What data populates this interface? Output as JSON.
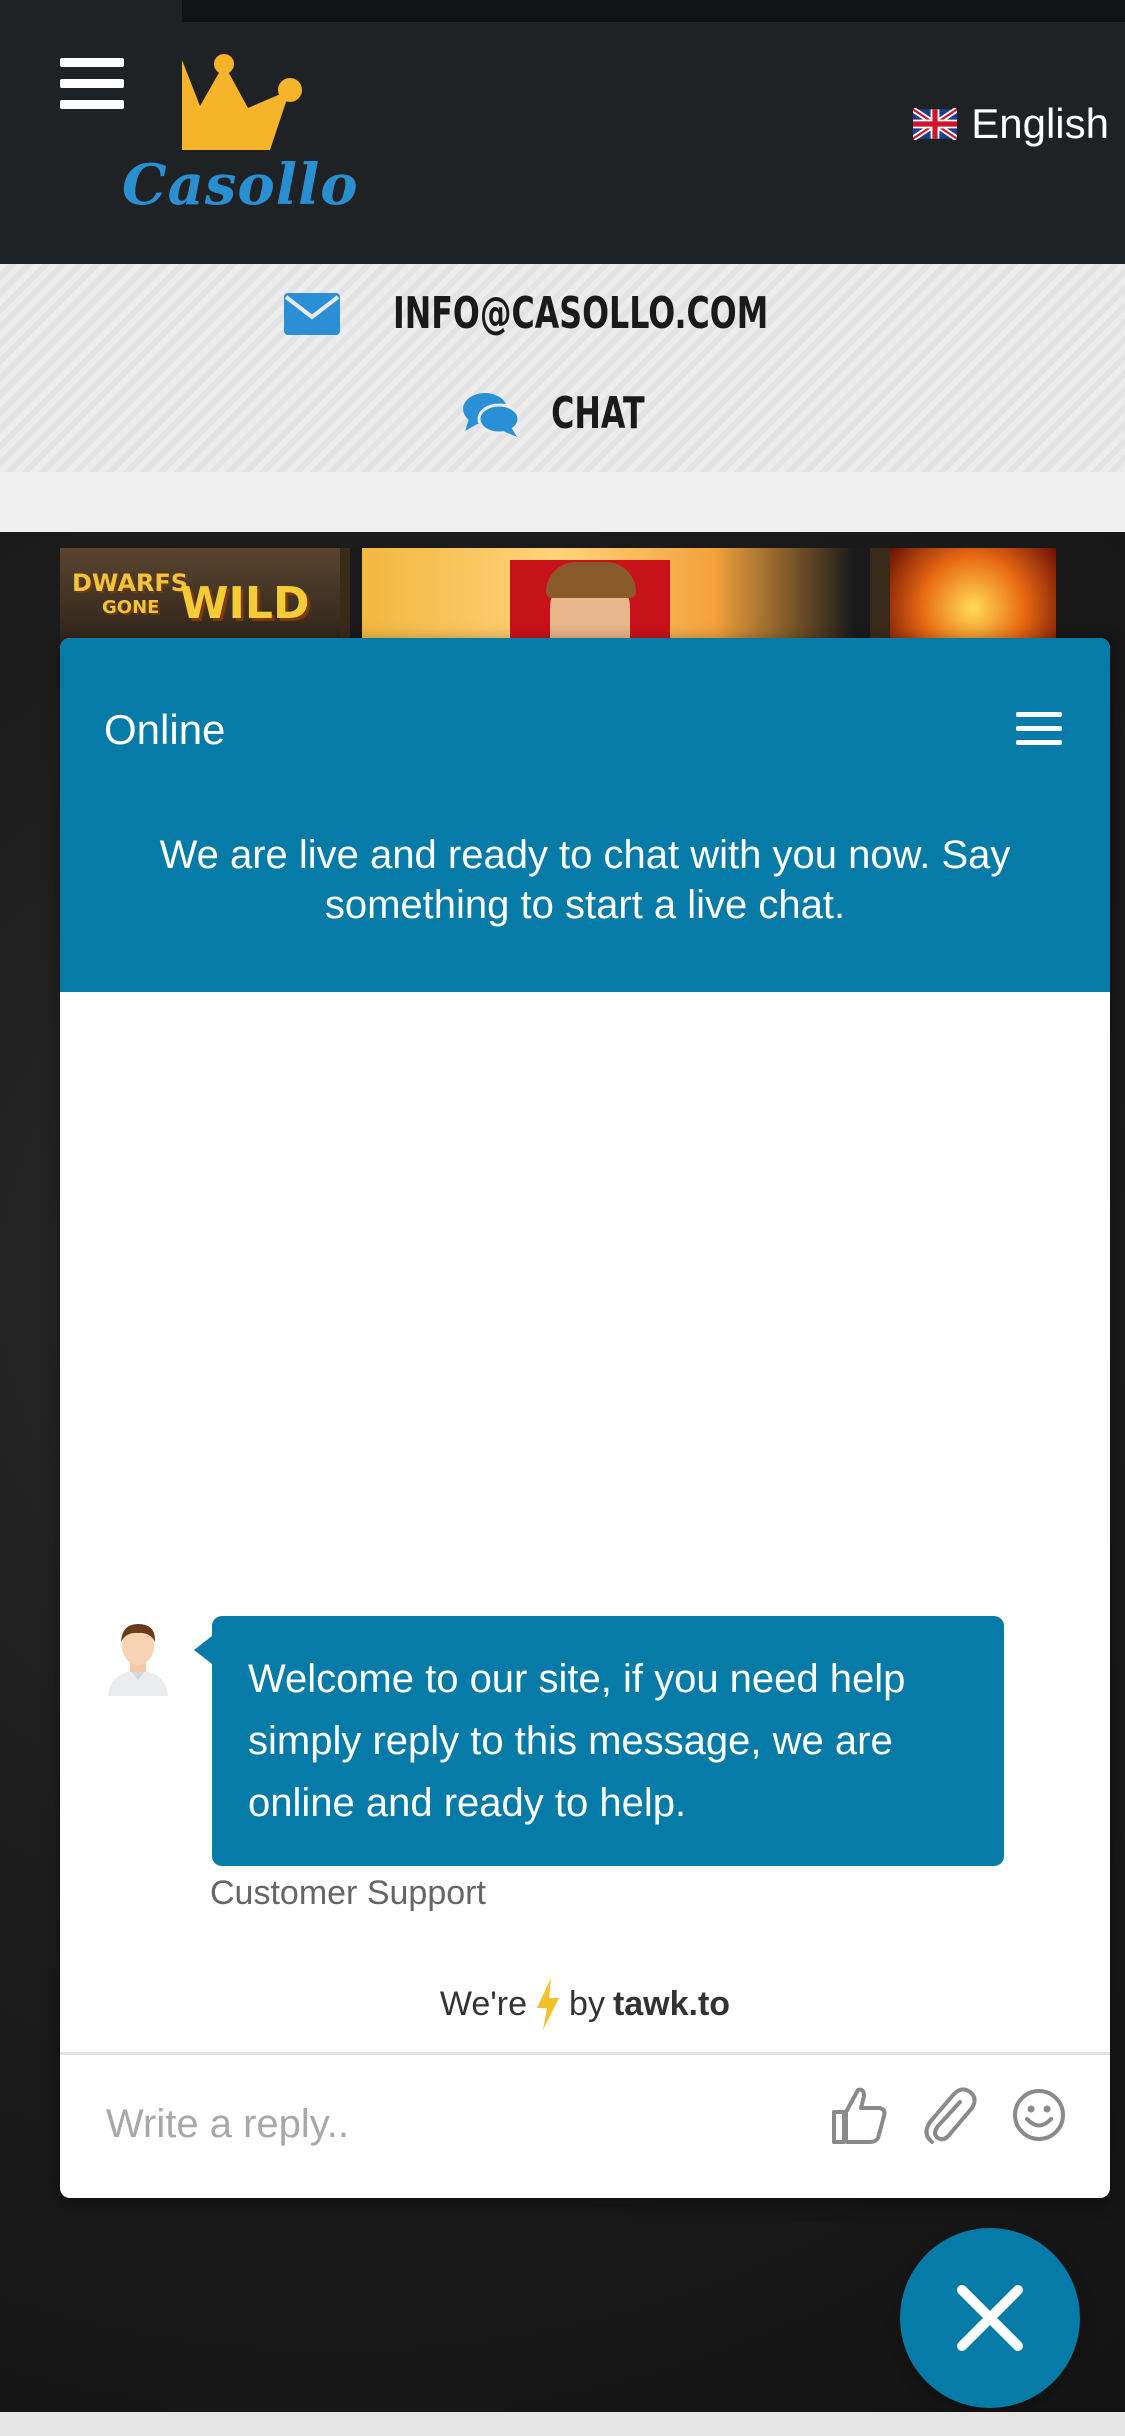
{
  "header": {
    "logo_text": "Casollo",
    "language": "English"
  },
  "contact": {
    "email": "INFO@CASOLLO.COM",
    "chat": "CHAT"
  },
  "banner": {
    "game_1_top": "DWARFS",
    "game_1_sub": "GONE",
    "game_1_word": "WILD"
  },
  "chat_widget": {
    "status": "Online",
    "intro": "We are live and ready to chat with you now. Say something to start a live chat.",
    "message": "Welcome to our site, if you need help simply reply to this message, we are online and ready to help.",
    "sender": "Customer Support",
    "powered_pre": "We're",
    "powered_mid": "by",
    "powered_brand": "tawk.to",
    "reply_placeholder": "Write a reply..",
    "accent_color": "#077ba8"
  },
  "icons": [
    "hamburger-icon",
    "uk-flag-icon",
    "envelope-icon",
    "chat-bubbles-icon",
    "menu-icon",
    "thumbs-up-icon",
    "paperclip-icon",
    "emoji-icon",
    "close-icon",
    "lightning-icon"
  ]
}
